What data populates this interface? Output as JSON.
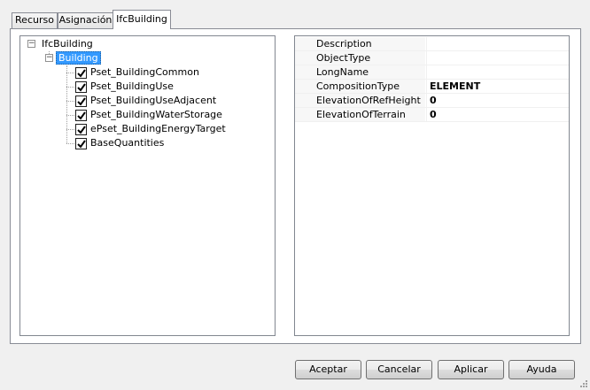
{
  "tabs": [
    {
      "label": "Recurso",
      "active": false
    },
    {
      "label": "Asignación",
      "active": false
    },
    {
      "label": "IfcBuilding",
      "active": true
    }
  ],
  "tree": {
    "root": {
      "label": "IfcBuilding",
      "expanded": true
    },
    "child": {
      "label": "Building",
      "expanded": true,
      "selected": true
    },
    "items": [
      {
        "label": "Pset_BuildingCommon",
        "checked": true
      },
      {
        "label": "Pset_BuildingUse",
        "checked": true
      },
      {
        "label": "Pset_BuildingUseAdjacent",
        "checked": true
      },
      {
        "label": "Pset_BuildingWaterStorage",
        "checked": true
      },
      {
        "label": "ePset_BuildingEnergyTarget",
        "checked": true
      },
      {
        "label": "BaseQuantities",
        "checked": true
      }
    ]
  },
  "properties": [
    {
      "name": "Description",
      "value": ""
    },
    {
      "name": "ObjectType",
      "value": ""
    },
    {
      "name": "LongName",
      "value": ""
    },
    {
      "name": "CompositionType",
      "value": "ELEMENT"
    },
    {
      "name": "ElevationOfRefHeight",
      "value": "0"
    },
    {
      "name": "ElevationOfTerrain",
      "value": "0"
    }
  ],
  "buttons": {
    "accept": "Aceptar",
    "cancel": "Cancelar",
    "apply": "Aplicar",
    "help": "Ayuda"
  },
  "colors": {
    "selection": "#3399ff",
    "background": "#f0f0f0"
  }
}
